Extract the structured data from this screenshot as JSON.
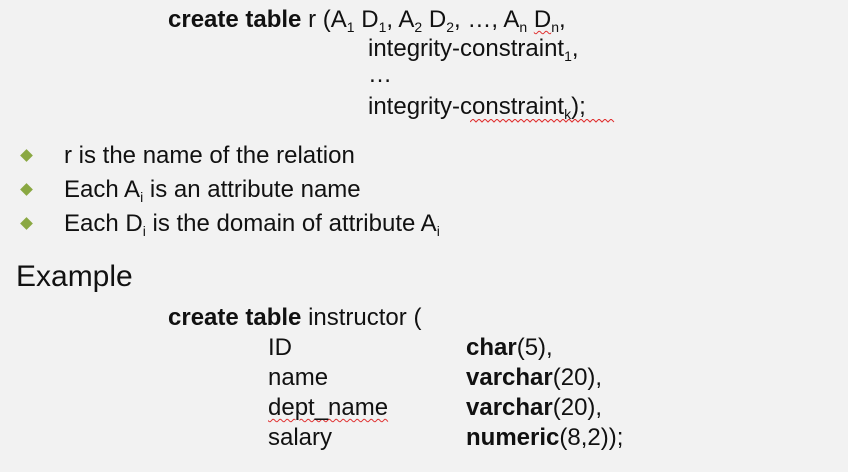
{
  "syntax": {
    "kw": "create table",
    "rel": " r (",
    "attr_letter": "A",
    "dom_letter": "D",
    "sub1": "1",
    "sub2": "2",
    "subn": "n",
    "ellipsis_comma": ", …, ",
    "comma": ", ",
    "tail_comma": ",",
    "constraint": "integrity-constraint",
    "sub_k": "k",
    "ellipsis": "…",
    "close": ");"
  },
  "bullets": [
    {
      "text": "r is the name of the relation"
    },
    {
      "prefix": "Each ",
      "letter": "A",
      "sub": "i",
      "suffix": " is an attribute name"
    },
    {
      "prefix": "Each ",
      "letter": "D",
      "sub": "i",
      "suffix": " is the domain of attribute ",
      "letter2": "A",
      "sub2": "i"
    }
  ],
  "colors": {
    "bullet": "#8aa842",
    "spellcheck": "#e03030",
    "background": "#f2f2f2"
  },
  "example": {
    "heading": "Example",
    "kw": "create table",
    "table_open": " instructor (",
    "rows": [
      {
        "name": "ID",
        "type_kw": "char",
        "args": "(5),"
      },
      {
        "name": "name",
        "type_kw": "varchar",
        "args": "(20),"
      },
      {
        "name": "dept_name",
        "type_kw": "varchar",
        "args": "(20),"
      },
      {
        "name": "salary",
        "type_kw": "numeric",
        "args": "(8,2));"
      }
    ]
  }
}
